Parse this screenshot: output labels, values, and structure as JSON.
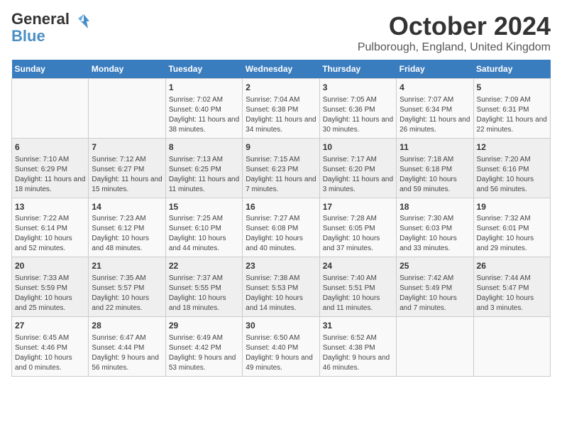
{
  "logo": {
    "line1": "General",
    "line2": "Blue"
  },
  "title": "October 2024",
  "subtitle": "Pulborough, England, United Kingdom",
  "days_of_week": [
    "Sunday",
    "Monday",
    "Tuesday",
    "Wednesday",
    "Thursday",
    "Friday",
    "Saturday"
  ],
  "weeks": [
    [
      {
        "day": "",
        "content": ""
      },
      {
        "day": "",
        "content": ""
      },
      {
        "day": "1",
        "content": "Sunrise: 7:02 AM\nSunset: 6:40 PM\nDaylight: 11 hours and 38 minutes."
      },
      {
        "day": "2",
        "content": "Sunrise: 7:04 AM\nSunset: 6:38 PM\nDaylight: 11 hours and 34 minutes."
      },
      {
        "day": "3",
        "content": "Sunrise: 7:05 AM\nSunset: 6:36 PM\nDaylight: 11 hours and 30 minutes."
      },
      {
        "day": "4",
        "content": "Sunrise: 7:07 AM\nSunset: 6:34 PM\nDaylight: 11 hours and 26 minutes."
      },
      {
        "day": "5",
        "content": "Sunrise: 7:09 AM\nSunset: 6:31 PM\nDaylight: 11 hours and 22 minutes."
      }
    ],
    [
      {
        "day": "6",
        "content": "Sunrise: 7:10 AM\nSunset: 6:29 PM\nDaylight: 11 hours and 18 minutes."
      },
      {
        "day": "7",
        "content": "Sunrise: 7:12 AM\nSunset: 6:27 PM\nDaylight: 11 hours and 15 minutes."
      },
      {
        "day": "8",
        "content": "Sunrise: 7:13 AM\nSunset: 6:25 PM\nDaylight: 11 hours and 11 minutes."
      },
      {
        "day": "9",
        "content": "Sunrise: 7:15 AM\nSunset: 6:23 PM\nDaylight: 11 hours and 7 minutes."
      },
      {
        "day": "10",
        "content": "Sunrise: 7:17 AM\nSunset: 6:20 PM\nDaylight: 11 hours and 3 minutes."
      },
      {
        "day": "11",
        "content": "Sunrise: 7:18 AM\nSunset: 6:18 PM\nDaylight: 10 hours and 59 minutes."
      },
      {
        "day": "12",
        "content": "Sunrise: 7:20 AM\nSunset: 6:16 PM\nDaylight: 10 hours and 56 minutes."
      }
    ],
    [
      {
        "day": "13",
        "content": "Sunrise: 7:22 AM\nSunset: 6:14 PM\nDaylight: 10 hours and 52 minutes."
      },
      {
        "day": "14",
        "content": "Sunrise: 7:23 AM\nSunset: 6:12 PM\nDaylight: 10 hours and 48 minutes."
      },
      {
        "day": "15",
        "content": "Sunrise: 7:25 AM\nSunset: 6:10 PM\nDaylight: 10 hours and 44 minutes."
      },
      {
        "day": "16",
        "content": "Sunrise: 7:27 AM\nSunset: 6:08 PM\nDaylight: 10 hours and 40 minutes."
      },
      {
        "day": "17",
        "content": "Sunrise: 7:28 AM\nSunset: 6:05 PM\nDaylight: 10 hours and 37 minutes."
      },
      {
        "day": "18",
        "content": "Sunrise: 7:30 AM\nSunset: 6:03 PM\nDaylight: 10 hours and 33 minutes."
      },
      {
        "day": "19",
        "content": "Sunrise: 7:32 AM\nSunset: 6:01 PM\nDaylight: 10 hours and 29 minutes."
      }
    ],
    [
      {
        "day": "20",
        "content": "Sunrise: 7:33 AM\nSunset: 5:59 PM\nDaylight: 10 hours and 25 minutes."
      },
      {
        "day": "21",
        "content": "Sunrise: 7:35 AM\nSunset: 5:57 PM\nDaylight: 10 hours and 22 minutes."
      },
      {
        "day": "22",
        "content": "Sunrise: 7:37 AM\nSunset: 5:55 PM\nDaylight: 10 hours and 18 minutes."
      },
      {
        "day": "23",
        "content": "Sunrise: 7:38 AM\nSunset: 5:53 PM\nDaylight: 10 hours and 14 minutes."
      },
      {
        "day": "24",
        "content": "Sunrise: 7:40 AM\nSunset: 5:51 PM\nDaylight: 10 hours and 11 minutes."
      },
      {
        "day": "25",
        "content": "Sunrise: 7:42 AM\nSunset: 5:49 PM\nDaylight: 10 hours and 7 minutes."
      },
      {
        "day": "26",
        "content": "Sunrise: 7:44 AM\nSunset: 5:47 PM\nDaylight: 10 hours and 3 minutes."
      }
    ],
    [
      {
        "day": "27",
        "content": "Sunrise: 6:45 AM\nSunset: 4:46 PM\nDaylight: 10 hours and 0 minutes."
      },
      {
        "day": "28",
        "content": "Sunrise: 6:47 AM\nSunset: 4:44 PM\nDaylight: 9 hours and 56 minutes."
      },
      {
        "day": "29",
        "content": "Sunrise: 6:49 AM\nSunset: 4:42 PM\nDaylight: 9 hours and 53 minutes."
      },
      {
        "day": "30",
        "content": "Sunrise: 6:50 AM\nSunset: 4:40 PM\nDaylight: 9 hours and 49 minutes."
      },
      {
        "day": "31",
        "content": "Sunrise: 6:52 AM\nSunset: 4:38 PM\nDaylight: 9 hours and 46 minutes."
      },
      {
        "day": "",
        "content": ""
      },
      {
        "day": "",
        "content": ""
      }
    ]
  ]
}
